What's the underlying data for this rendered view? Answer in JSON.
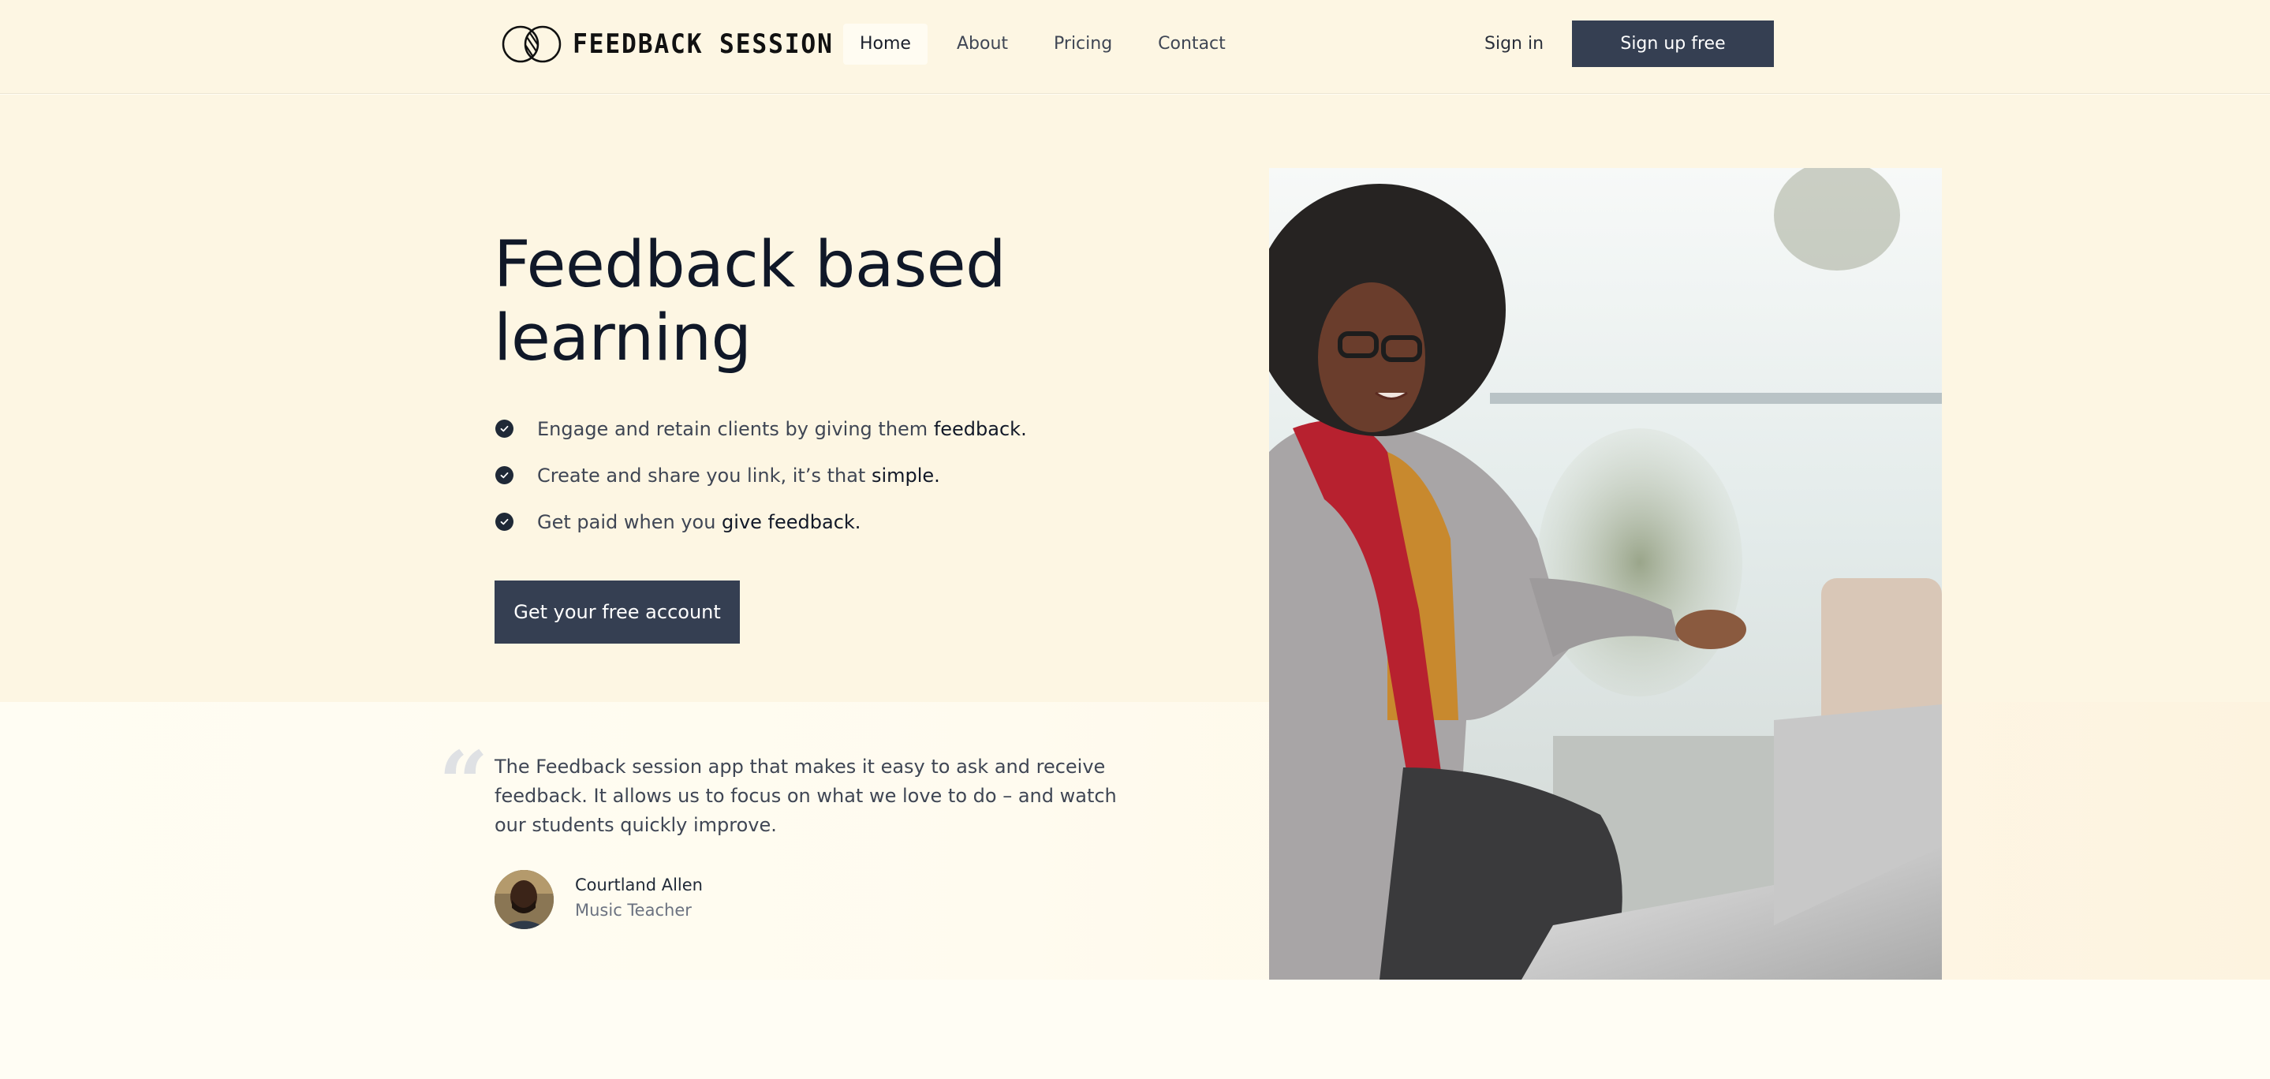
{
  "header": {
    "logo_text": "FEEDBACK SESSION",
    "nav": [
      {
        "label": "Home",
        "active": true
      },
      {
        "label": "About",
        "active": false
      },
      {
        "label": "Pricing",
        "active": false
      },
      {
        "label": "Contact",
        "active": false
      }
    ],
    "signin_label": "Sign in",
    "signup_label": "Sign up free"
  },
  "hero": {
    "title": "Feedback based learning",
    "features": [
      {
        "text": "Engage and retain clients by giving them ",
        "bold": "feedback."
      },
      {
        "text": "Create and share you link, it’s that ",
        "bold": "simple."
      },
      {
        "text": "Get paid when you ",
        "bold": "give feedback."
      }
    ],
    "cta_label": "Get your free account"
  },
  "testimonial": {
    "quote_mark": "“",
    "quote": "The Feedback session app that makes it easy to ask and receive feedback. It allows us to focus on what we love to do – and watch our students quickly improve.",
    "author_name": "Courtland Allen",
    "author_role": "Music Teacher"
  },
  "colors": {
    "page_background": "#fdf6e3",
    "button_dark": "#353f52",
    "heading": "#101828",
    "body_text": "#3f4654"
  },
  "icons": {
    "logo": "interlocking-circles-logo-icon",
    "feature_bullet": "check-circle-icon"
  }
}
